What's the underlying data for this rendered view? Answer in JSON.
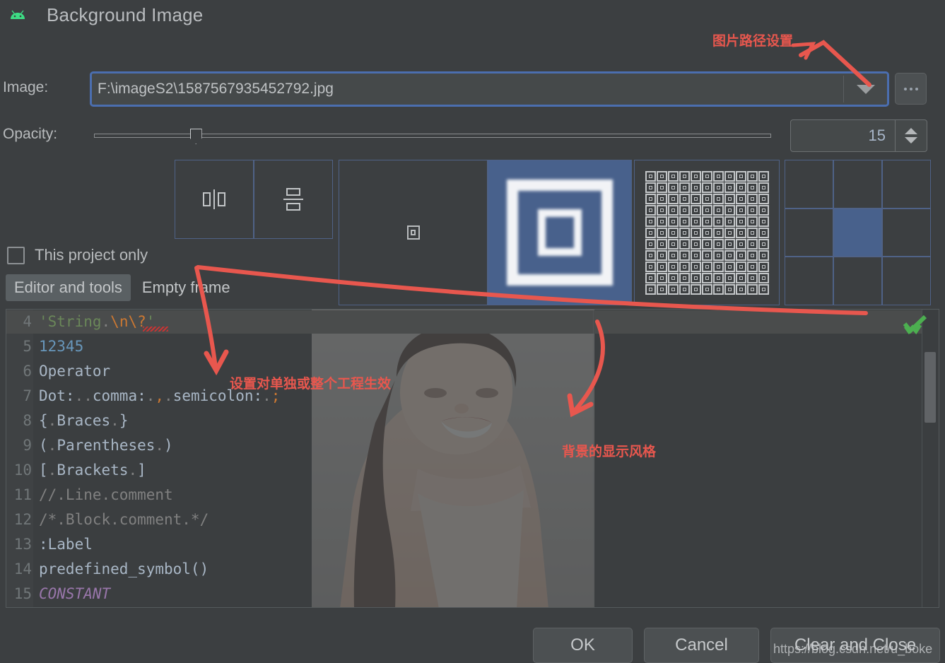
{
  "dialog": {
    "title": "Background Image",
    "icon": "android-icon"
  },
  "image_row": {
    "label": "Image:",
    "value": "F:\\imageS2\\1587567935452792.jpg",
    "placeholder": "",
    "dropdown_icon": "chevron-down-icon",
    "browse_label": "…"
  },
  "opacity_row": {
    "label": "Opacity:",
    "value": "15",
    "slider_percent": 15,
    "min": 0,
    "max": 100
  },
  "style_buttons": [
    {
      "name": "flip-horizontal",
      "icon": "flip-horizontal-icon",
      "selected": false
    },
    {
      "name": "flip-vertical",
      "icon": "flip-vertical-icon",
      "selected": false
    },
    {
      "name": "single-image",
      "icon": "single-image-icon",
      "selected": false
    },
    {
      "name": "scaled-image",
      "icon": "scaled-image-icon",
      "selected": true
    },
    {
      "name": "tiled-image",
      "icon": "tiled-image-icon",
      "selected": false
    }
  ],
  "anchor_grid": {
    "selected_index": 4,
    "cells": [
      "top-left",
      "top-center",
      "top-right",
      "middle-left",
      "center",
      "middle-right",
      "bottom-left",
      "bottom-center",
      "bottom-right"
    ]
  },
  "project_only": {
    "label": "This project only",
    "checked": false
  },
  "tabs": [
    {
      "label": "Editor and tools",
      "active": true
    },
    {
      "label": "Empty frame",
      "active": false
    }
  ],
  "code_preview": {
    "inspection_icon": "green-check-icon",
    "lines": [
      {
        "num": "4",
        "parts": [
          {
            "t": "'String",
            "c": "c-str"
          },
          {
            "t": ".",
            "c": "c-dot"
          },
          {
            "t": "\\n\\?",
            "c": "c-esc"
          },
          {
            "t": "'",
            "c": "c-str"
          }
        ]
      },
      {
        "num": "5",
        "parts": [
          {
            "t": "12345",
            "c": "c-num"
          }
        ]
      },
      {
        "num": "6",
        "parts": [
          {
            "t": "Operator",
            "c": "c-def"
          }
        ]
      },
      {
        "num": "7",
        "parts": [
          {
            "t": "Dot:",
            "c": "c-def"
          },
          {
            "t": "..",
            "c": "c-dot"
          },
          {
            "t": "comma:",
            "c": "c-def"
          },
          {
            "t": ".",
            "c": "c-dot"
          },
          {
            "t": ",",
            "c": "c-esc"
          },
          {
            "t": ".",
            "c": "c-dot"
          },
          {
            "t": "semicolon:",
            "c": "c-def"
          },
          {
            "t": ".",
            "c": "c-dot"
          },
          {
            "t": ";",
            "c": "c-esc"
          }
        ]
      },
      {
        "num": "8",
        "parts": [
          {
            "t": "{",
            "c": "c-def"
          },
          {
            "t": ".",
            "c": "c-dot"
          },
          {
            "t": "Braces",
            "c": "c-def"
          },
          {
            "t": ".",
            "c": "c-dot"
          },
          {
            "t": "}",
            "c": "c-def"
          }
        ]
      },
      {
        "num": "9",
        "parts": [
          {
            "t": "(",
            "c": "c-def"
          },
          {
            "t": ".",
            "c": "c-dot"
          },
          {
            "t": "Parentheses",
            "c": "c-def"
          },
          {
            "t": ".",
            "c": "c-dot"
          },
          {
            "t": ")",
            "c": "c-def"
          }
        ]
      },
      {
        "num": "10",
        "parts": [
          {
            "t": "[",
            "c": "c-def"
          },
          {
            "t": ".",
            "c": "c-dot"
          },
          {
            "t": "Brackets",
            "c": "c-def"
          },
          {
            "t": ".",
            "c": "c-dot"
          },
          {
            "t": "]",
            "c": "c-def"
          }
        ]
      },
      {
        "num": "11",
        "parts": [
          {
            "t": "//.Line.comment",
            "c": "c-cmt"
          }
        ]
      },
      {
        "num": "12",
        "parts": [
          {
            "t": "/*.Block.comment.*/",
            "c": "c-cmt"
          }
        ]
      },
      {
        "num": "13",
        "parts": [
          {
            "t": ":Label",
            "c": "c-def"
          }
        ]
      },
      {
        "num": "14",
        "parts": [
          {
            "t": "predefined_symbol()",
            "c": "c-def"
          }
        ]
      },
      {
        "num": "15",
        "parts": [
          {
            "t": "CONSTANT",
            "c": "c-const"
          }
        ]
      }
    ]
  },
  "footer": {
    "ok": "OK",
    "cancel": "Cancel",
    "clear_and_close": "Clear and Close",
    "watermark": "https://blog.csdn.net/u_boke"
  },
  "annotations": [
    {
      "id": "anno-1",
      "text": "图片路径设置"
    },
    {
      "id": "anno-2",
      "text": "设置对单独或整个工程生效"
    },
    {
      "id": "anno-3",
      "text": "背景的显示风格"
    }
  ],
  "colors": {
    "accent_blue": "#4b6eaf",
    "selected_tile": "#48618c",
    "annotation_red": "#e8574e",
    "panel_bg": "#3c3f41"
  }
}
